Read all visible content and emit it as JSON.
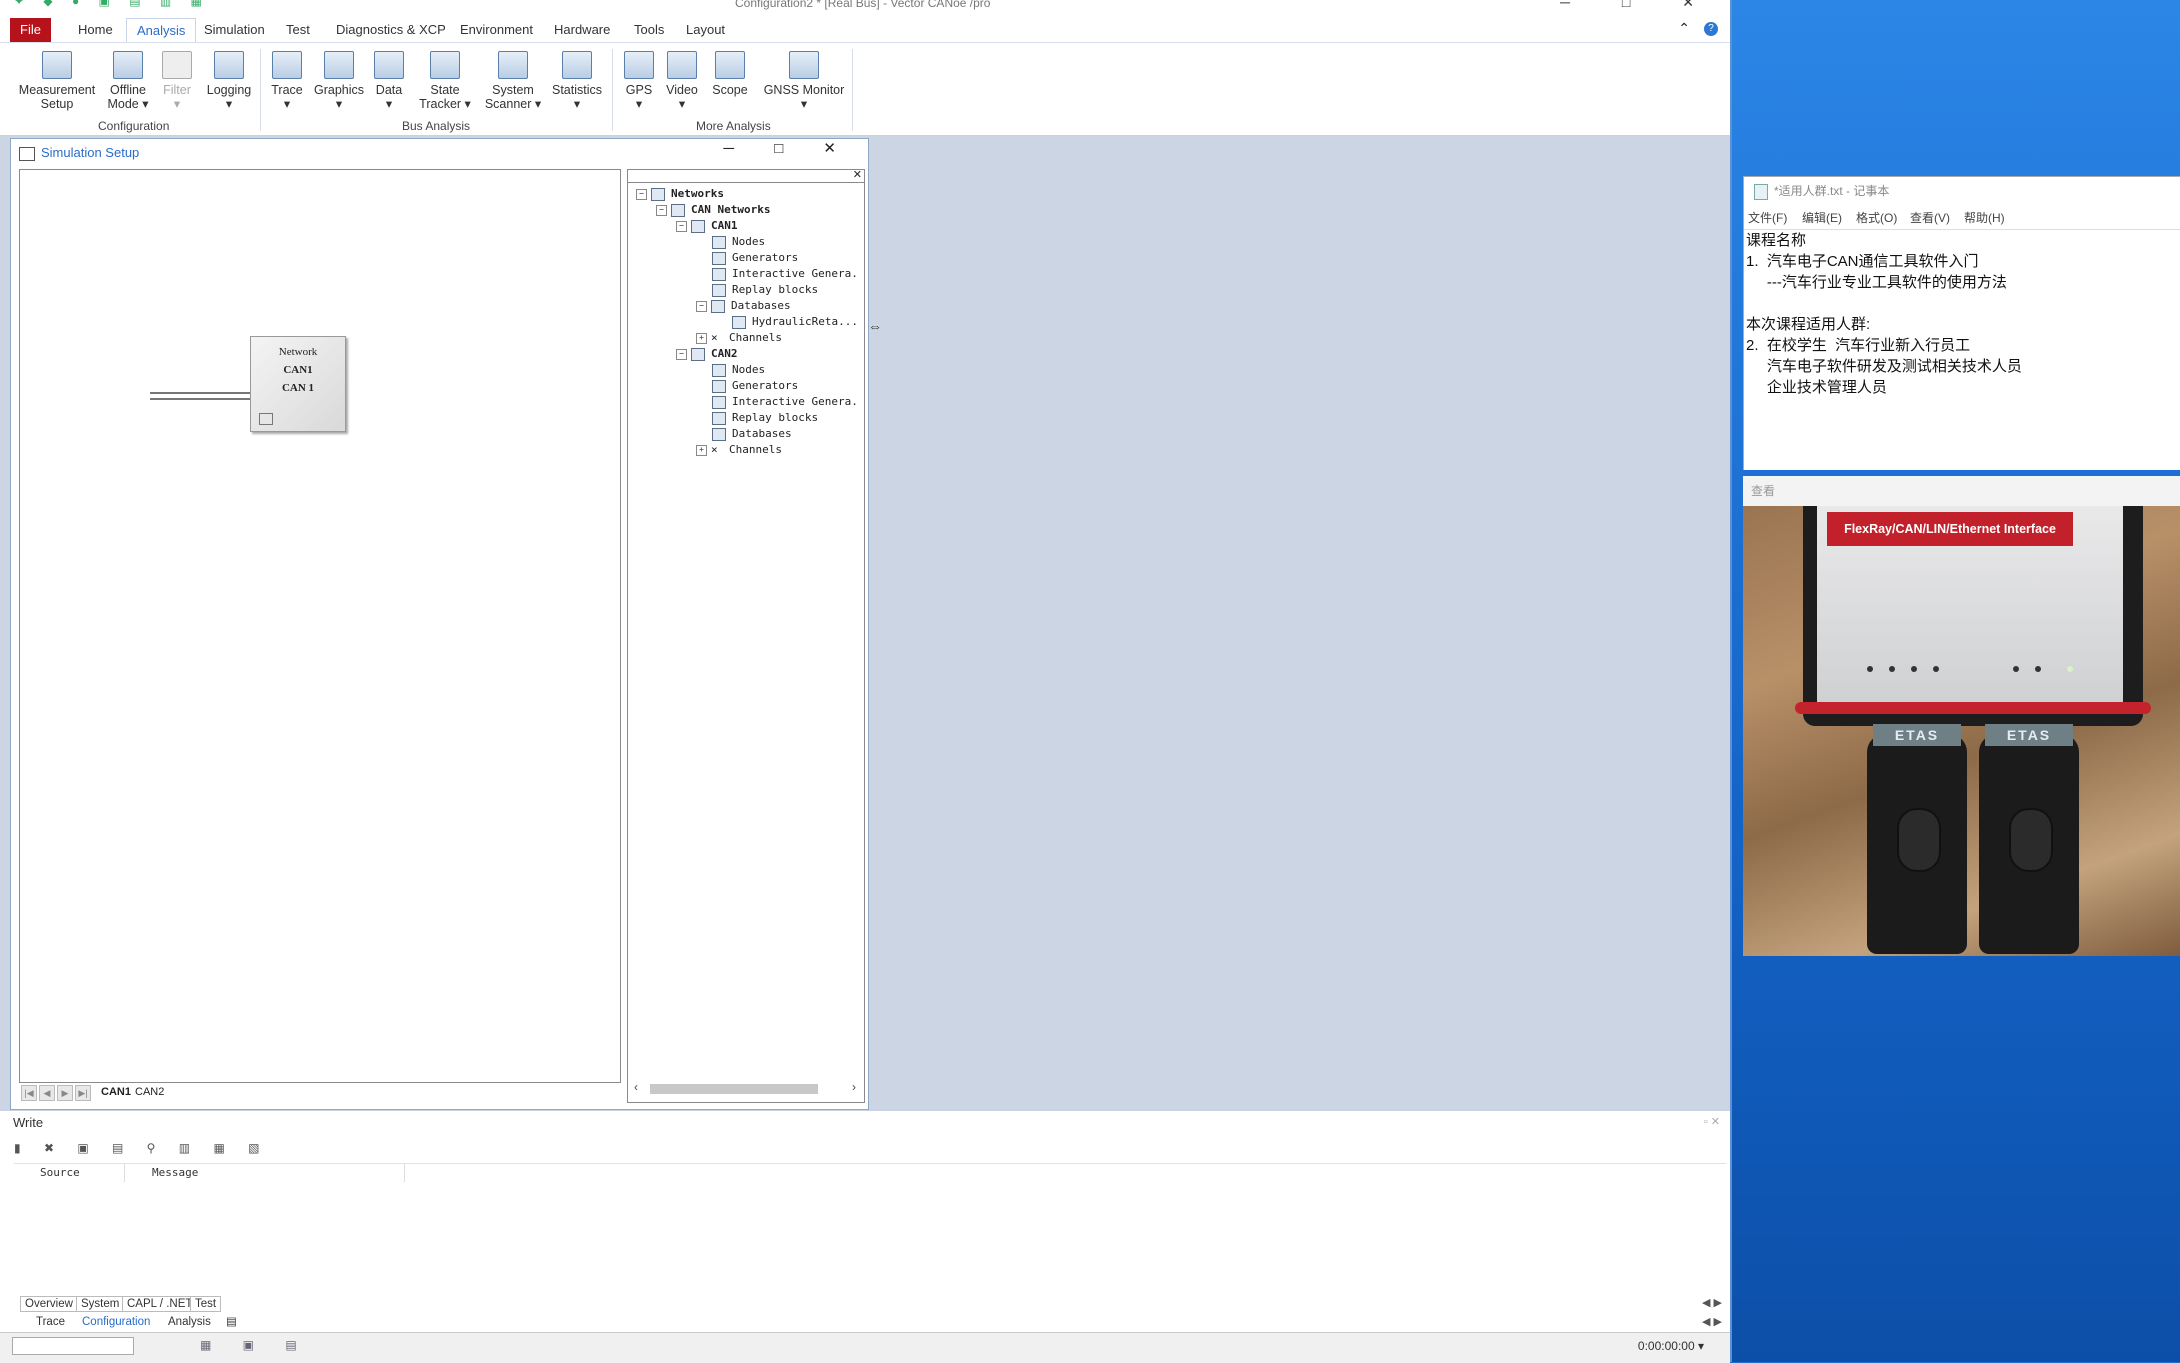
{
  "window": {
    "title": "Configuration2 * [Real Bus] - Vector CANoe /pro"
  },
  "menu": {
    "file": "File",
    "tabs": [
      "Home",
      "Analysis",
      "Simulation",
      "Test",
      "Diagnostics & XCP",
      "Environment",
      "Hardware",
      "Tools",
      "Layout"
    ],
    "active_tab": "Analysis",
    "help": "?"
  },
  "ribbon": {
    "buttons": [
      {
        "l1": "Measurement",
        "l2": "Setup"
      },
      {
        "l1": "Offline",
        "l2": "Mode ▾"
      },
      {
        "l1": "Filter",
        "l2": "▾"
      },
      {
        "l1": "Logging",
        "l2": "▾"
      },
      {
        "l1": "Trace",
        "l2": "▾"
      },
      {
        "l1": "Graphics",
        "l2": "▾"
      },
      {
        "l1": "Data",
        "l2": "▾"
      },
      {
        "l1": "State",
        "l2": "Tracker ▾"
      },
      {
        "l1": "System",
        "l2": "Scanner ▾"
      },
      {
        "l1": "Statistics",
        "l2": "▾"
      },
      {
        "l1": "GPS",
        "l2": "▾"
      },
      {
        "l1": "Video",
        "l2": "▾"
      },
      {
        "l1": "Scope",
        "l2": ""
      },
      {
        "l1": "GNSS Monitor",
        "l2": "▾"
      }
    ],
    "groups": [
      "Configuration",
      "Bus Analysis",
      "More Analysis"
    ]
  },
  "sim_setup": {
    "title": "Simulation Setup",
    "network_box": [
      "Network",
      "CAN1",
      "CAN 1"
    ],
    "sheet_tabs": [
      "CAN1",
      "CAN2"
    ],
    "tree": [
      {
        "label": "Networks",
        "bold": true
      },
      {
        "label": "CAN Networks",
        "bold": true
      },
      {
        "label": "CAN1",
        "bold": true
      },
      {
        "label": "Nodes"
      },
      {
        "label": "Generators"
      },
      {
        "label": "Interactive Genera."
      },
      {
        "label": "Replay blocks"
      },
      {
        "label": "Databases"
      },
      {
        "label": "HydraulicReta..."
      },
      {
        "label": "Channels"
      },
      {
        "label": "CAN2",
        "bold": true
      },
      {
        "label": "Nodes"
      },
      {
        "label": "Generators"
      },
      {
        "label": "Interactive Genera."
      },
      {
        "label": "Replay blocks"
      },
      {
        "label": "Databases"
      },
      {
        "label": "Channels"
      }
    ]
  },
  "write_window": {
    "title": "Write",
    "columns": [
      "Source",
      "Message"
    ]
  },
  "bottom_tabs": [
    "Overview",
    "System",
    "CAPL / .NET",
    "Test"
  ],
  "doc_tabs": [
    "Trace",
    "Configuration",
    "Analysis"
  ],
  "doc_tabs_active": "Configuration",
  "status": {
    "time": "0:00:00:00 ▾"
  },
  "notepad": {
    "title": "*适用人群.txt - 记事本",
    "menu": [
      "文件(F)",
      "编辑(E)",
      "格式(O)",
      "查看(V)",
      "帮助(H)"
    ],
    "lines": [
      "课程名称",
      "1.  汽车电子CAN通信工具软件入门",
      "     ---汽车行业专业工具软件的使用方法",
      "",
      "本次课程适用人群:",
      "2.  在校学生  汽车行业新入行员工",
      "     汽车电子软件研发及测试相关技术人员",
      "     企业技术管理人员"
    ]
  },
  "camera": {
    "label": "查看",
    "device_label": "FlexRay/CAN/LIN/Ethernet Interface",
    "connector_label": "ETAS"
  }
}
